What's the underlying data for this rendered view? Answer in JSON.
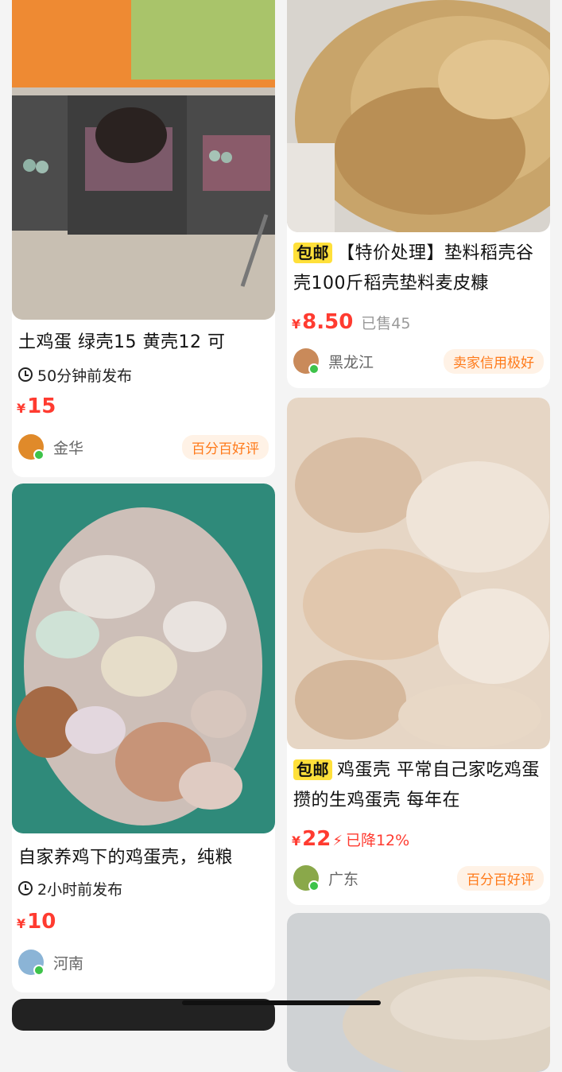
{
  "feed": {
    "left": [
      {
        "title": "土鸡蛋 绿壳15 黄壳12 可",
        "posted_time": "50分钟前发布",
        "currency": "¥",
        "price": "15",
        "location": "金华",
        "tag": "百分百好评",
        "image_icon": "chicken-eggs-crates-photo"
      },
      {
        "title": "自家养鸡下的鸡蛋壳，纯粮",
        "posted_time": "2小时前发布",
        "currency": "¥",
        "price": "10",
        "location": "河南",
        "image_icon": "eggshells-bag-photo"
      }
    ],
    "right": [
      {
        "badge": "包邮",
        "title": "【特价处理】垫料稻壳谷壳100斤稻壳垫料麦皮糠",
        "currency": "¥",
        "price": "8.50",
        "sold": "已售45",
        "location": "黑龙江",
        "tag": "卖家信用极好",
        "image_icon": "rice-husk-photo"
      },
      {
        "badge": "包邮",
        "title": "鸡蛋壳 平常自己家吃鸡蛋 攒的生鸡蛋壳 每年在",
        "currency": "¥",
        "price": "22",
        "price_drop": "已降12%",
        "location": "广东",
        "tag": "百分百好评",
        "image_icon": "crushed-eggshells-photo"
      },
      {
        "image_icon": "ground-shell-powder-photo"
      }
    ]
  },
  "colors": {
    "price_red": "#ff3b30",
    "badge_yellow": "#ffe03a",
    "tag_orange": "#ff7a1a",
    "online_green": "#3ec34a"
  }
}
